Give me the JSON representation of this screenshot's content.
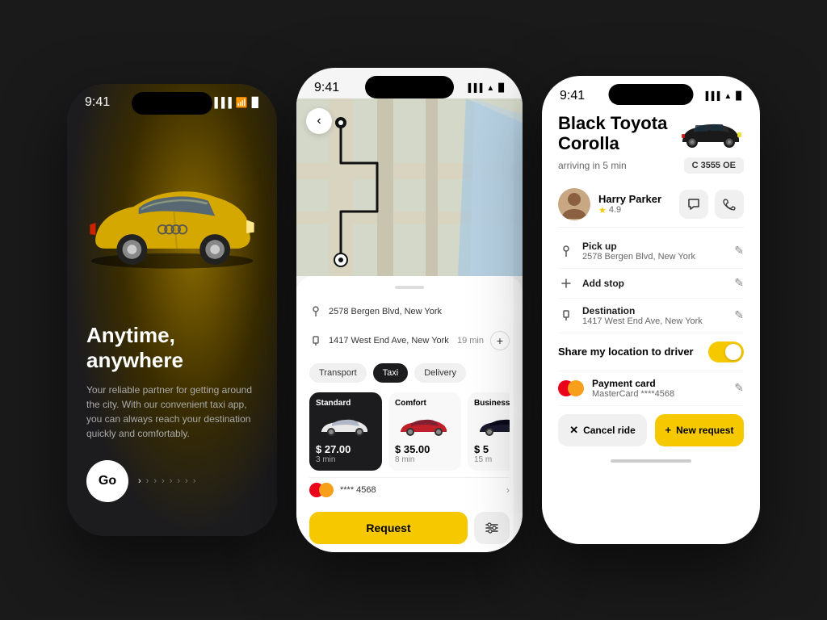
{
  "phone1": {
    "status_time": "9:41",
    "title": "Anytime, anywhere",
    "subtitle": "Your reliable partner for getting around the city. With our convenient taxi app, you can always reach your destination quickly and comfortably.",
    "go_button": "Go",
    "arrows": [
      "›",
      "›",
      "›",
      "›",
      "›",
      "›",
      "›",
      "›",
      "›"
    ]
  },
  "phone2": {
    "status_time": "9:41",
    "pickup": "2578 Bergen Blvd, New York",
    "destination": "1417 West End Ave, New York",
    "eta": "19 min",
    "tabs": [
      "Transport",
      "Taxi",
      "Delivery"
    ],
    "active_tab": "Taxi",
    "cars": [
      {
        "name": "Standard",
        "price": "$ 27.00",
        "time": "3 min",
        "selected": true
      },
      {
        "name": "Comfort",
        "price": "$ 35.00",
        "time": "8 min",
        "selected": false
      },
      {
        "name": "Business",
        "price": "$ 5",
        "time": "15 m",
        "selected": false
      }
    ],
    "payment_card": "**** 4568",
    "request_button": "Request"
  },
  "phone3": {
    "status_time": "9:41",
    "car_title": "Black Toyota Corolla",
    "arriving": "arriving in 5 min",
    "plate": "C 3555 OE",
    "driver_name": "Harry Parker",
    "driver_rating": "4.9",
    "pickup_label": "Pick up",
    "pickup_value": "2578 Bergen Blvd, New York",
    "add_stop_label": "Add stop",
    "destination_label": "Destination",
    "destination_value": "1417 West End Ave, New York",
    "share_label": "Share my location to driver",
    "payment_label": "Payment card",
    "payment_value": "MasterCard ****4568",
    "cancel_button": "Cancel ride",
    "new_request_button": "New request"
  }
}
